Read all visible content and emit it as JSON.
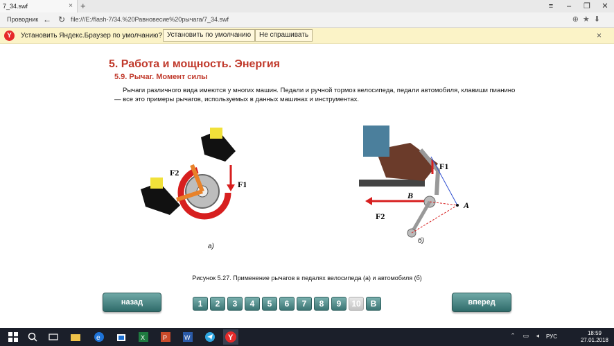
{
  "browser": {
    "tab_title": "7_34.swf",
    "tab_close": "×",
    "new_tab": "+",
    "explorer_label": "Проводник",
    "url": "file:///E:/flash-7/34.%20Равновесие%20рычага/7_34.swf",
    "window_controls": [
      "≡",
      "–",
      "❐",
      "✕"
    ]
  },
  "infobar": {
    "text": "Установить Яндекс.Браузер по умолчанию?",
    "set_default": "Установить по умолчанию",
    "dont_ask": "Не спрашивать",
    "close": "×"
  },
  "page": {
    "title": "5. Работа и мощность. Энергия",
    "subtitle": "5.9. Рычаг. Момент силы",
    "paragraph": "Рычаги различного вида имеются у многих машин. Педали и ручной тормоз велосипеда, педали автомобиля, клавиши пианино — все это примеры рычагов, используемых в данных машинах и инструментах.",
    "figure_a_label": "а)",
    "figure_b_label": "б)",
    "caption": "Рисунок 5.27. Применение рычагов в педалях велосипеда (а) и автомобиля (б)",
    "labels": {
      "f1": "F1",
      "f2": "F2",
      "b": "B",
      "a": "A"
    },
    "back": "назад",
    "forward": "вперед",
    "pages": [
      "1",
      "2",
      "3",
      "4",
      "5",
      "6",
      "7",
      "8",
      "9",
      "10",
      "B"
    ],
    "active_page": "10"
  },
  "taskbar": {
    "lang": "РУС",
    "time": "18:59",
    "date": "27.01.2018"
  },
  "colors": {
    "accent_red": "#c0392b",
    "nav_teal": "#3b7574",
    "infobar": "#fbf3c7"
  }
}
